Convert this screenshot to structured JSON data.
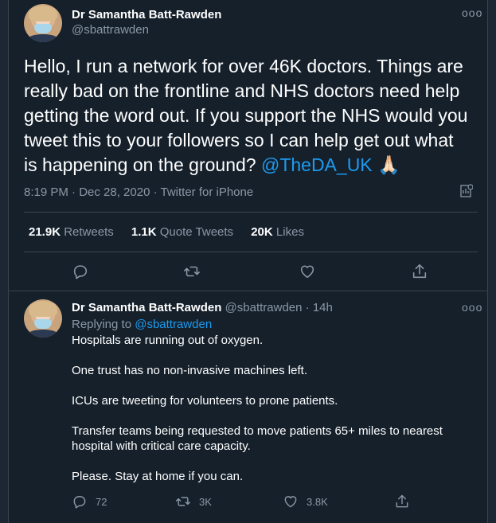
{
  "tweet": {
    "author_name": "Dr Samantha Batt-Rawden",
    "author_handle": "@sbattrawden",
    "text_before_mention": "Hello, I run a network for over 46K doctors. Things are really bad on the frontline and NHS doctors need help getting the word out. If you support the NHS would you tweet this to your followers so I can help get out what is happening on the ground? ",
    "mention": "@TheDA_UK",
    "emoji": "🙏🏻",
    "timestamp": "8:19 PM · Dec 28, 2020 · Twitter for iPhone",
    "retweets_count": "21.9K",
    "retweets_label": "Retweets",
    "quote_count": "1.1K",
    "quote_label": "Quote Tweets",
    "likes_count": "20K",
    "likes_label": "Likes"
  },
  "reply": {
    "author_name": "Dr Samantha Batt-Rawden",
    "author_handle": "@sbattrawden",
    "time": "· 14h",
    "replying_prefix": "Replying to ",
    "replying_to": "@sbattrawden",
    "paragraphs": [
      "Hospitals are running out of oxygen.",
      "One trust has no non-invasive machines left.",
      "ICUs are tweeting for volunteers to prone patients.",
      "Transfer teams being requested to move patients 65+ miles to nearest hospital with critical care capacity.",
      "Please. Stay at home if you can."
    ],
    "reply_count": "72",
    "retweet_count": "3K",
    "like_count": "3.8K"
  },
  "icons": {
    "more": "more-icon",
    "reply": "reply-icon",
    "retweet": "retweet-icon",
    "like": "heart-icon",
    "share": "share-icon",
    "analytics": "analytics-icon"
  },
  "colors": {
    "background": "#15202b",
    "accent": "#1d9bf0",
    "muted": "#8b98a5"
  }
}
